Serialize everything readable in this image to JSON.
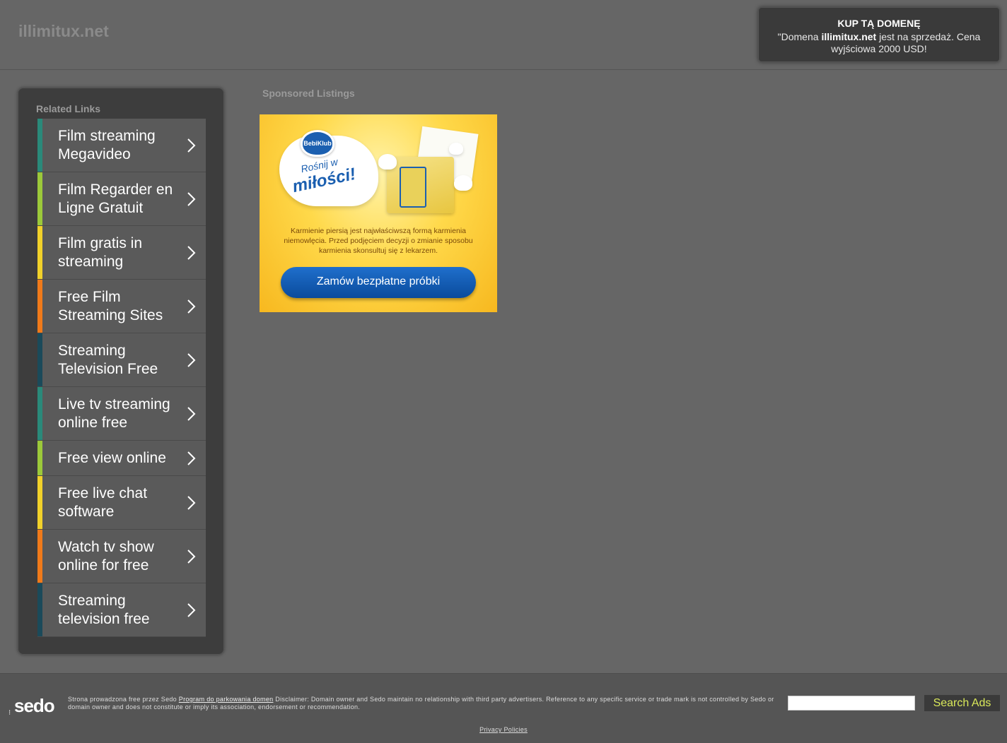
{
  "header": {
    "site_title": "illimitux.net",
    "buy_box": {
      "title": "KUP TĄ DOMENĘ",
      "text_prefix": "\"Domena ",
      "domain": "illimitux.net",
      "text_suffix": " jest na sprzedaż. Cena wyjściowa 2000 USD!"
    }
  },
  "related": {
    "title": "Related Links",
    "items": [
      {
        "label": "Film streaming Megavideo",
        "color": "#2a8a7a",
        "lines": 2
      },
      {
        "label": "Film Regarder en Ligne Gratuit",
        "color": "#9cc93a",
        "lines": 2
      },
      {
        "label": "Film gratis in streaming",
        "color": "#f1d12a",
        "lines": 2
      },
      {
        "label": "Free Film Streaming Sites",
        "color": "#f07a1a",
        "lines": 2
      },
      {
        "label": "Streaming Television Free",
        "color": "#1b4a5a",
        "lines": 2
      },
      {
        "label": "Live tv streaming online free",
        "color": "#2a8a7a",
        "lines": 2
      },
      {
        "label": "Free view online",
        "color": "#9cc93a",
        "lines": 1
      },
      {
        "label": "Free live chat software",
        "color": "#f1d12a",
        "lines": 2
      },
      {
        "label": "Watch tv show online for free",
        "color": "#f07a1a",
        "lines": 2
      },
      {
        "label": "Streaming television free",
        "color": "#1b4a5a",
        "lines": 2
      }
    ]
  },
  "sponsored": {
    "title": "Sponsored Listings",
    "ad": {
      "brand": "BebiKlub",
      "slogan_small": "Rośnij w",
      "slogan_big": "miłości!",
      "disclaimer": "Karmienie piersią jest najwłaściwszą formą karmienia niemowlęcia. Przed podjęciem decyzji o zmianie sposobu karmienia skonsultuj się z lekarzem.",
      "button": "Zamów bezpłatne próbki"
    }
  },
  "footer": {
    "logo": "sedo",
    "disclaimer_prefix": "Strona prowadzona free przez Sedo ",
    "disclaimer_link": "Program do parkowania domen",
    "disclaimer_suffix": " Disclaimer: Domain owner and Sedo maintain no relationship with third party advertisers. Reference to any specific service or trade mark is not controlled by Sedo or domain owner and does not constitute or imply its association, endorsement or recommendation.",
    "search_value": "",
    "search_button": "Search Ads",
    "privacy": "Privacy Policies"
  }
}
